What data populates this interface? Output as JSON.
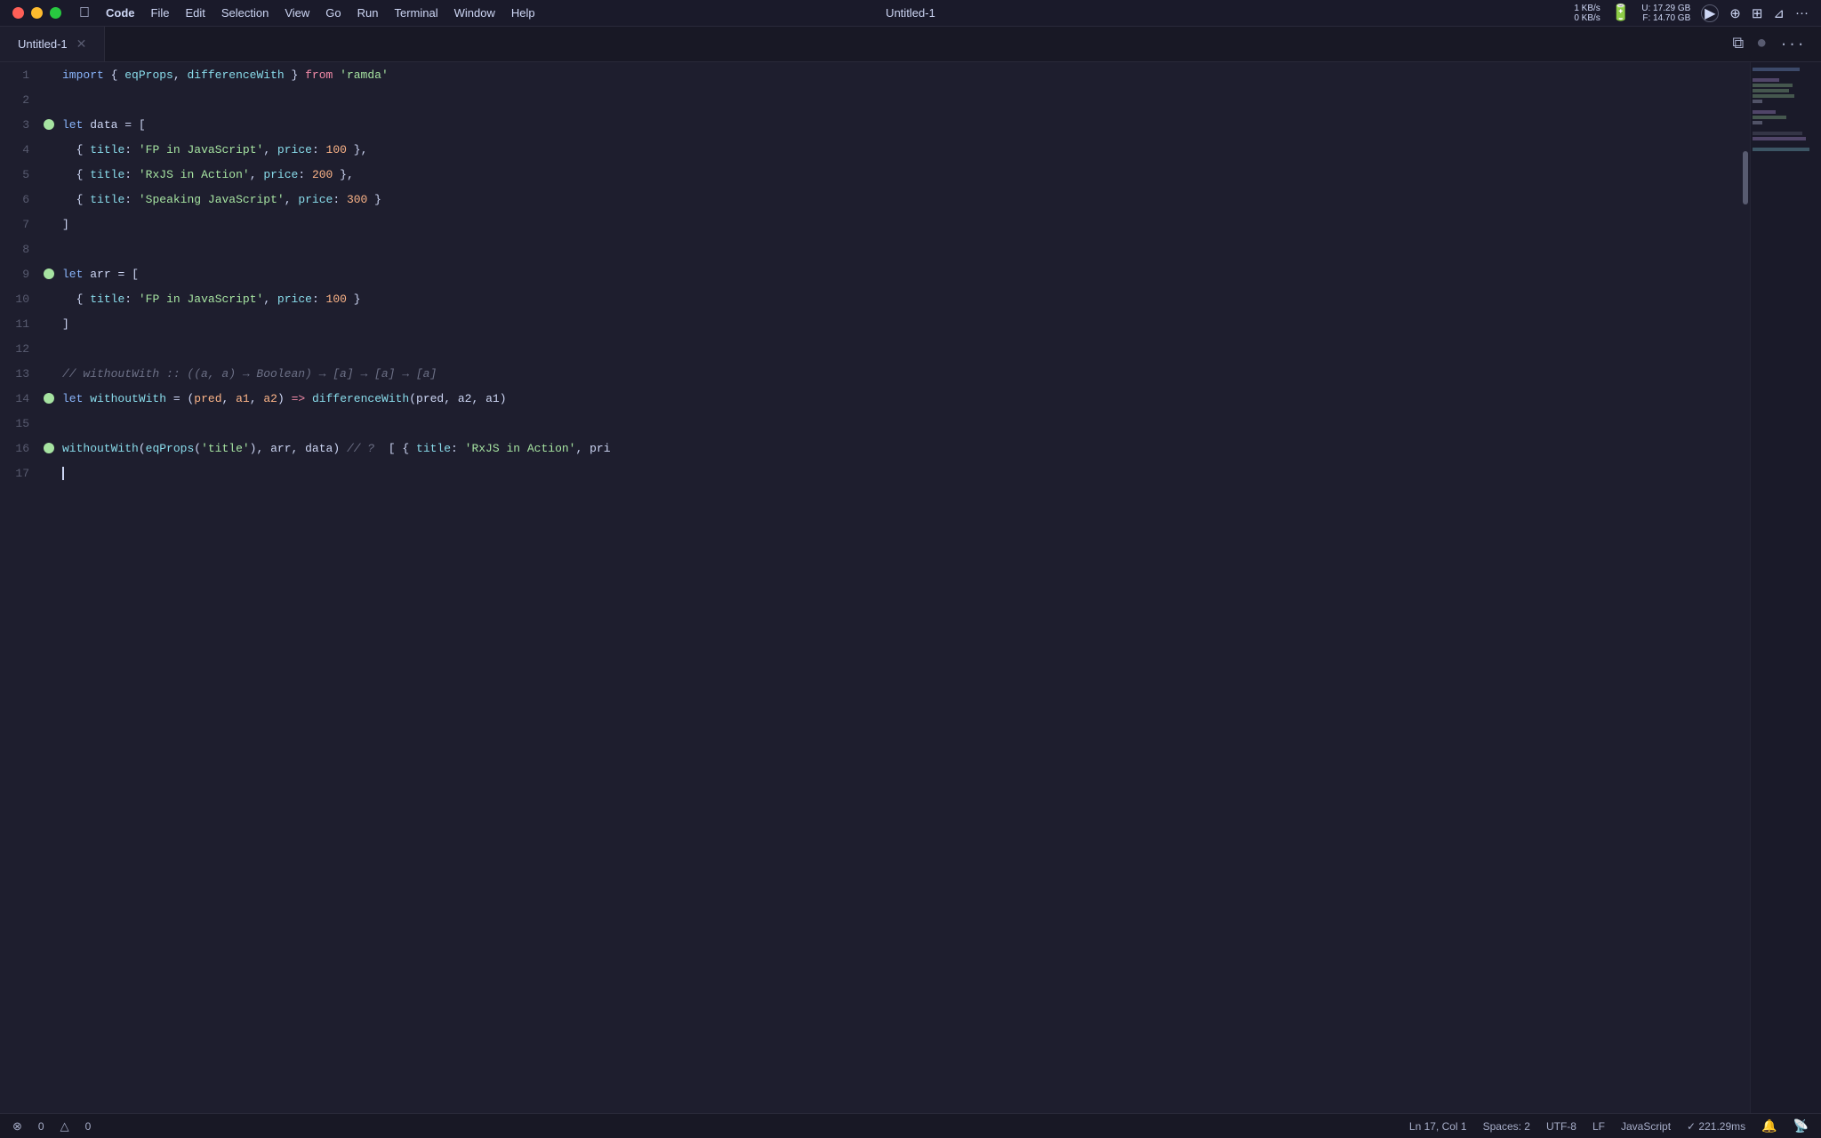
{
  "titlebar": {
    "apple_label": "",
    "menu": [
      "Code",
      "File",
      "Edit",
      "Selection",
      "View",
      "Go",
      "Run",
      "Terminal",
      "Window",
      "Help"
    ],
    "title": "Untitled-1",
    "sys_stats": {
      "line1": "1 KB/s",
      "line2": "0 KB/s"
    },
    "mem_stats": {
      "line1": "U: 17.29 GB",
      "line2": "F: 14.70 GB"
    }
  },
  "tab": {
    "label": "Untitled-1"
  },
  "statusbar": {
    "errors": "0",
    "warnings": "0",
    "position": "Ln 17, Col 1",
    "spaces": "Spaces: 2",
    "encoding": "UTF-8",
    "eol": "LF",
    "language": "JavaScript",
    "timing": "✓ 221.29ms"
  },
  "lines": [
    {
      "num": 1,
      "bp": false
    },
    {
      "num": 2,
      "bp": false
    },
    {
      "num": 3,
      "bp": true
    },
    {
      "num": 4,
      "bp": false
    },
    {
      "num": 5,
      "bp": false
    },
    {
      "num": 6,
      "bp": false
    },
    {
      "num": 7,
      "bp": false
    },
    {
      "num": 8,
      "bp": false
    },
    {
      "num": 9,
      "bp": true
    },
    {
      "num": 10,
      "bp": false
    },
    {
      "num": 11,
      "bp": false
    },
    {
      "num": 12,
      "bp": false
    },
    {
      "num": 13,
      "bp": false
    },
    {
      "num": 14,
      "bp": true
    },
    {
      "num": 15,
      "bp": false
    },
    {
      "num": 16,
      "bp": true
    },
    {
      "num": 17,
      "bp": false
    }
  ]
}
